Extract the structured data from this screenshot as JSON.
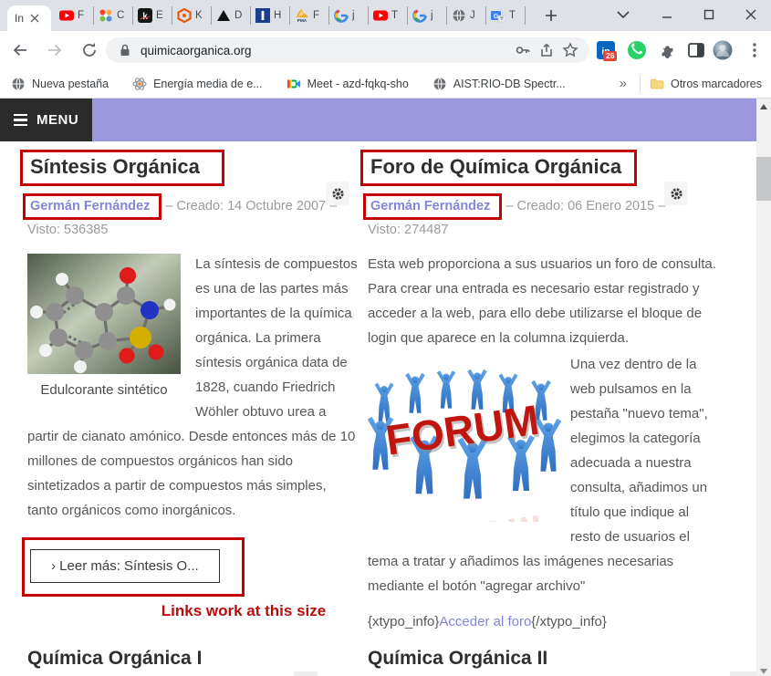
{
  "browser": {
    "active_tab": {
      "label": "In"
    },
    "tabs": [
      {
        "icon": "youtube-icon",
        "label": "F"
      },
      {
        "icon": "joomla-icon",
        "label": "C"
      },
      {
        "icon": "black-k-icon",
        "label": "E"
      },
      {
        "icon": "orange-hexagon-icon",
        "label": "K"
      },
      {
        "icon": "black-triangle-icon",
        "label": "D"
      },
      {
        "icon": "blue-i-icon",
        "label": "H"
      },
      {
        "icon": "phpmyadmin-icon",
        "label": "F"
      },
      {
        "icon": "google-icon",
        "label": "j"
      },
      {
        "icon": "youtube-icon",
        "label": "T"
      },
      {
        "icon": "google-icon",
        "label": "j"
      },
      {
        "icon": "globe-icon",
        "label": "J"
      },
      {
        "icon": "translate-icon",
        "label": "T"
      }
    ],
    "url": "quimicaorganica.org",
    "extensions": {
      "linkedin_badge": "26"
    },
    "bookmarks": [
      {
        "icon": "globe-icon",
        "label": "Nueva pestaña"
      },
      {
        "icon": "atom-icon",
        "label": "Energía media de e..."
      },
      {
        "icon": "meet-icon",
        "label": "Meet - azd-fqkq-sho"
      },
      {
        "icon": "globe-icon",
        "label": "AIST:RIO-DB Spectr..."
      }
    ],
    "bookmarks_overflow": "»",
    "other_bookmarks_label": "Otros marcadores"
  },
  "page": {
    "menu_label": "MENU",
    "annotation_note": "Links work at this size",
    "articles": [
      {
        "title": "Síntesis Orgánica",
        "author": "Germán Fernández",
        "created": "– Creado: 14 Octubre 2007 –",
        "views": "Visto: 536385",
        "image_caption": "Edulcorante sintético",
        "body": "La síntesis de compuestos es una de las partes más importantes de la química orgánica. La primera síntesis orgánica data de 1828, cuando Friedrich Wöhler obtuvo urea a partir de cianato amónico. Desde entonces más de 10 millones de compuestos orgánicos han sido sintetizados a partir de compuestos más simples, tanto orgánicos como inorgánicos.",
        "readmore": "› Leer más: Síntesis O...",
        "next_section_title": "Química Orgánica I"
      },
      {
        "title": "Foro de Química Orgánica",
        "author": "Germán Fernández",
        "created": "– Creado: 06 Enero 2015 –",
        "views": "Visto: 274487",
        "body_intro": "Esta web proporciona a sus usuarios un foro de consulta.  Para crear una entrada es necesario estar registrado y acceder a la web, para ello debe utilizarse el bloque de login que aparece en la columna izquierda.",
        "body_wrap": "Una vez dentro de la web pulsamos en la pestaña \"nuevo tema\", elegimos la categoría adecuada a nuestra consulta, añadimos un título que indique al resto de usuarios el tema a tratar y añadimos las imágenes necesarias mediante el botón \"agregar archivo\"",
        "xtypo_prefix": "{xtypo_info}",
        "forum_link_label": "Acceder al foro",
        "xtypo_suffix": "{/xtypo_info}",
        "forum_word": "FORUM",
        "next_section_title": "Química Orgánica II"
      }
    ]
  },
  "colors": {
    "banner": "#9b97dd",
    "annotation": "#c40000",
    "link": "#8385d9",
    "menu_bg": "#2b2b2b"
  }
}
